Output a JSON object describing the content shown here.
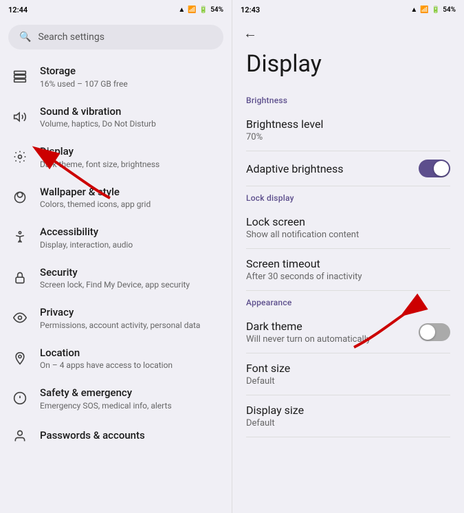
{
  "left": {
    "status": {
      "time": "12:44",
      "battery": "54%"
    },
    "search_placeholder": "Search settings",
    "items": [
      {
        "id": "storage",
        "icon": "☰",
        "title": "Storage",
        "subtitle": "16% used – 107 GB free"
      },
      {
        "id": "sound",
        "icon": "🔔",
        "title": "Sound & vibration",
        "subtitle": "Volume, haptics, Do Not Disturb"
      },
      {
        "id": "display",
        "icon": "⚙",
        "title": "Display",
        "subtitle": "Dark theme, font size, brightness"
      },
      {
        "id": "wallpaper",
        "icon": "🎨",
        "title": "Wallpaper & style",
        "subtitle": "Colors, themed icons, app grid"
      },
      {
        "id": "accessibility",
        "icon": "♿",
        "title": "Accessibility",
        "subtitle": "Display, interaction, audio"
      },
      {
        "id": "security",
        "icon": "🔒",
        "title": "Security",
        "subtitle": "Screen lock, Find My Device, app security"
      },
      {
        "id": "privacy",
        "icon": "👁",
        "title": "Privacy",
        "subtitle": "Permissions, account activity, personal data"
      },
      {
        "id": "location",
        "icon": "📍",
        "title": "Location",
        "subtitle": "On – 4 apps have access to location"
      },
      {
        "id": "safety",
        "icon": "✱",
        "title": "Safety & emergency",
        "subtitle": "Emergency SOS, medical info, alerts"
      },
      {
        "id": "passwords",
        "icon": "👤",
        "title": "Passwords & accounts",
        "subtitle": ""
      }
    ]
  },
  "right": {
    "status": {
      "time": "12:43",
      "battery": "54%"
    },
    "back_label": "←",
    "page_title": "Display",
    "sections": [
      {
        "label": "Brightness",
        "items": [
          {
            "id": "brightness-level",
            "title": "Brightness level",
            "subtitle": "70%",
            "has_toggle": false
          },
          {
            "id": "adaptive-brightness",
            "title": "Adaptive brightness",
            "subtitle": "",
            "has_toggle": true,
            "toggle_on": true
          }
        ]
      },
      {
        "label": "Lock display",
        "items": [
          {
            "id": "lock-screen",
            "title": "Lock screen",
            "subtitle": "Show all notification content",
            "has_toggle": false
          },
          {
            "id": "screen-timeout",
            "title": "Screen timeout",
            "subtitle": "After 30 seconds of inactivity",
            "has_toggle": false
          }
        ]
      },
      {
        "label": "Appearance",
        "items": [
          {
            "id": "dark-theme",
            "title": "Dark theme",
            "subtitle": "Will never turn on automatically",
            "has_toggle": true,
            "toggle_on": false
          },
          {
            "id": "font-size",
            "title": "Font size",
            "subtitle": "Default",
            "has_toggle": false
          },
          {
            "id": "display-size",
            "title": "Display size",
            "subtitle": "Default",
            "has_toggle": false
          }
        ]
      }
    ]
  }
}
